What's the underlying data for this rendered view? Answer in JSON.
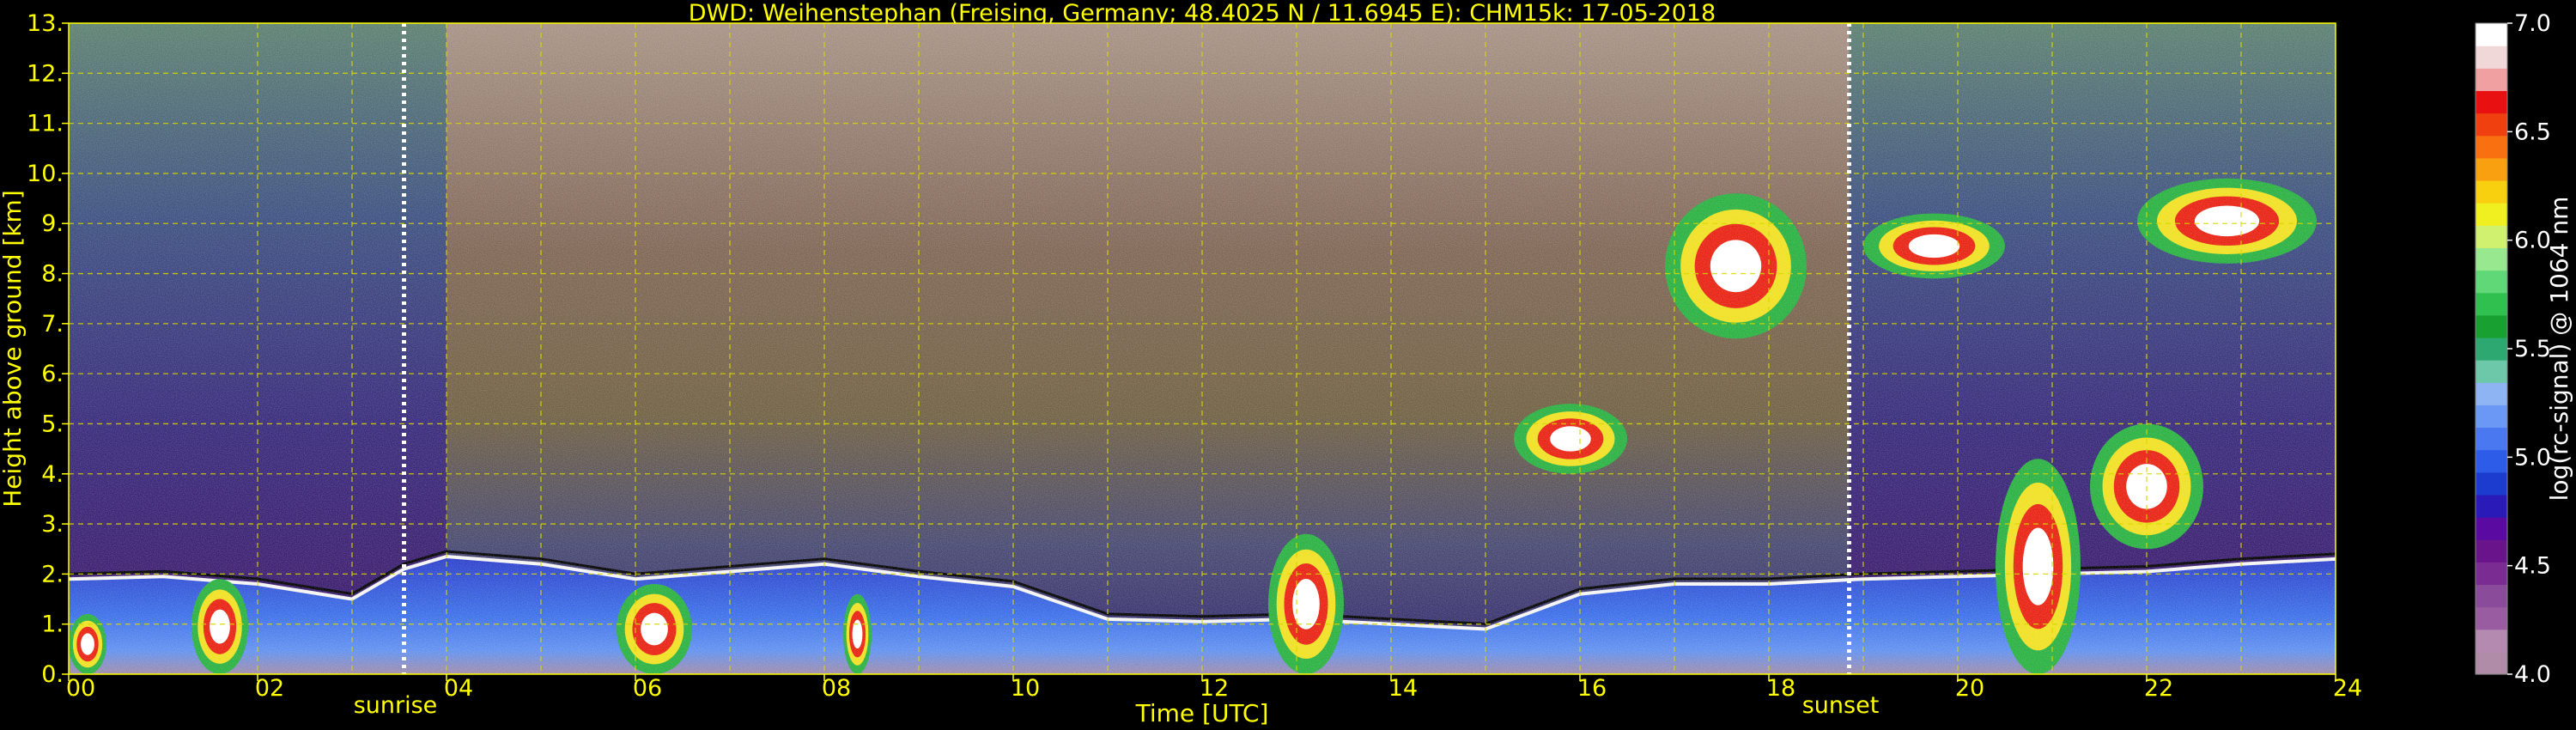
{
  "chart_data": {
    "type": "heatmap",
    "title": "DWD: Weihenstephan (Freising, Germany; 48.4025 N / 11.6945 E):    CHM15k: 17-05-2018",
    "xlabel": "Time [UTC]",
    "ylabel": "Height above ground [km]",
    "xlim": [
      0,
      24
    ],
    "ylim": [
      0,
      13
    ],
    "x_ticks": [
      "00",
      "02",
      "04",
      "06",
      "08",
      "10",
      "12",
      "14",
      "16",
      "18",
      "20",
      "22",
      "24"
    ],
    "y_ticks": [
      "0.",
      "1.",
      "2.",
      "3.",
      "4.",
      "5.",
      "6.",
      "7.",
      "8.",
      "9.",
      "10.",
      "11.",
      "12.",
      "13."
    ],
    "grid": true,
    "colorbar": {
      "label": "log(rc-signal) @ 1064 nm",
      "range": [
        4.0,
        7.0
      ],
      "ticks": [
        "4.0",
        "4.5",
        "5.0",
        "5.5",
        "6.0",
        "6.5",
        "7.0"
      ],
      "colors": [
        "#b08ca8",
        "#b48ab0",
        "#9a5ca0",
        "#8a4c9a",
        "#7a2c92",
        "#6a148c",
        "#5a0aa0",
        "#2a1ab8",
        "#1c3cd0",
        "#2c5ce8",
        "#4a78f0",
        "#6a98f4",
        "#8eb4f4",
        "#6cc8a8",
        "#2ca870",
        "#18a030",
        "#30c050",
        "#60d878",
        "#98e890",
        "#d0f070",
        "#f0f020",
        "#f8d010",
        "#f8a010",
        "#f87010",
        "#f04010",
        "#e81010",
        "#f0a0a0",
        "#f0d8d8",
        "#ffffff"
      ]
    },
    "annotations": [
      {
        "label": "sunrise",
        "time": 3.55
      },
      {
        "label": "sunset",
        "time": 18.85
      }
    ],
    "features": {
      "boundary_layer_top_km": [
        [
          0,
          1.9
        ],
        [
          1,
          1.95
        ],
        [
          2,
          1.8
        ],
        [
          3,
          1.5
        ],
        [
          3.55,
          2.1
        ],
        [
          4,
          2.35
        ],
        [
          5,
          2.2
        ],
        [
          6,
          1.9
        ],
        [
          7,
          2.05
        ],
        [
          8,
          2.2
        ],
        [
          9,
          1.95
        ],
        [
          10,
          1.75
        ],
        [
          11,
          1.1
        ],
        [
          12,
          1.05
        ],
        [
          13,
          1.1
        ],
        [
          14,
          1.0
        ],
        [
          15,
          0.9
        ],
        [
          16,
          1.6
        ],
        [
          17,
          1.8
        ],
        [
          18,
          1.8
        ],
        [
          19,
          1.9
        ],
        [
          20,
          1.95
        ],
        [
          21,
          2.0
        ],
        [
          22,
          2.05
        ],
        [
          23,
          2.2
        ],
        [
          24,
          2.3
        ]
      ],
      "clouds": [
        {
          "t0": 0.0,
          "t1": 0.4,
          "h0": 0.0,
          "h1": 1.2
        },
        {
          "t0": 1.3,
          "t1": 1.9,
          "h0": 0.0,
          "h1": 1.9
        },
        {
          "t0": 5.8,
          "t1": 6.6,
          "h0": 0.0,
          "h1": 1.8
        },
        {
          "t0": 8.2,
          "t1": 8.5,
          "h0": 0.0,
          "h1": 1.6
        },
        {
          "t0": 12.7,
          "t1": 13.5,
          "h0": 0.0,
          "h1": 2.8
        },
        {
          "t0": 15.3,
          "t1": 16.5,
          "h0": 4.0,
          "h1": 5.4
        },
        {
          "t0": 16.9,
          "t1": 18.4,
          "h0": 6.7,
          "h1": 9.6
        },
        {
          "t0": 20.4,
          "t1": 21.3,
          "h0": 0.0,
          "h1": 4.3
        },
        {
          "t0": 21.4,
          "t1": 22.6,
          "h0": 2.5,
          "h1": 5.0
        },
        {
          "t0": 19.0,
          "t1": 20.5,
          "h0": 7.9,
          "h1": 9.2
        },
        {
          "t0": 21.9,
          "t1": 23.8,
          "h0": 8.2,
          "h1": 9.9
        }
      ]
    }
  }
}
